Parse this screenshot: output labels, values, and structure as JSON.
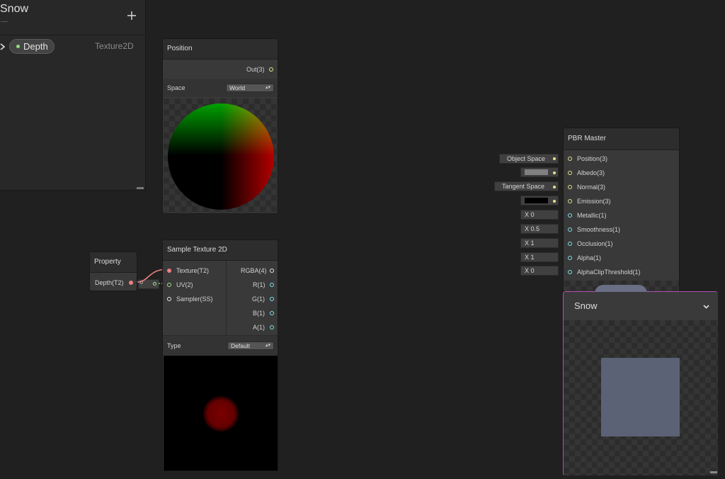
{
  "blackboard": {
    "title": "Snow",
    "add_icon": "plus-icon",
    "property": {
      "name": "Depth",
      "type": "Texture2D",
      "dot_color": "#8fe07a"
    }
  },
  "position_node": {
    "title": "Position",
    "output": "Out(3)",
    "space_label": "Space",
    "space_value": "World"
  },
  "property_node": {
    "title": "Property",
    "output": "Depth(T2)"
  },
  "sample_texture_node": {
    "title": "Sample Texture 2D",
    "inputs": [
      "Texture(T2)",
      "UV(2)",
      "Sampler(SS)"
    ],
    "outputs": [
      "RGBA(4)",
      "R(1)",
      "G(1)",
      "B(1)",
      "A(1)"
    ],
    "type_label": "Type",
    "type_value": "Default",
    "uv_chip": "0"
  },
  "pbr_master": {
    "title": "PBR Master",
    "inputs": [
      {
        "label": "Position(3)",
        "value": "Object Space",
        "kind": "text"
      },
      {
        "label": "Albedo(3)",
        "value": "",
        "kind": "color",
        "color": "#808080"
      },
      {
        "label": "Normal(3)",
        "value": "Tangent Space",
        "kind": "text"
      },
      {
        "label": "Emission(3)",
        "value": "",
        "kind": "color",
        "color": "#000000"
      },
      {
        "label": "Metallic(1)",
        "value": "X  0",
        "kind": "num"
      },
      {
        "label": "Smoothness(1)",
        "value": "X  0.5",
        "kind": "num"
      },
      {
        "label": "Occlusion(1)",
        "value": "X  1",
        "kind": "num"
      },
      {
        "label": "Alpha(1)",
        "value": "X  1",
        "kind": "num"
      },
      {
        "label": "AlphaClipThreshold(1)",
        "value": "X  0",
        "kind": "num"
      }
    ]
  },
  "main_preview": {
    "title": "Snow",
    "chevron_icon": "chevron-down-icon",
    "swatch_color": "#5b6275"
  }
}
